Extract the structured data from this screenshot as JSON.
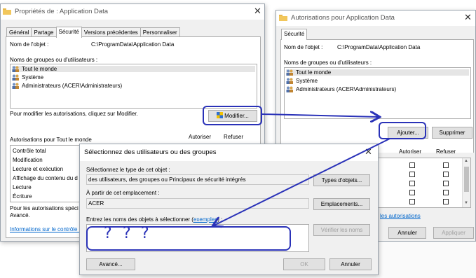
{
  "props_window": {
    "title": "Propriétés de : Application Data",
    "tabs": [
      "Général",
      "Partage",
      "Sécurité",
      "Versions précédentes",
      "Personnaliser"
    ],
    "object_name_label": "Nom de l'objet :",
    "object_name_value": "C:\\ProgramData\\Application Data",
    "groups_label": "Noms de groupes ou d'utilisateurs :",
    "groups": [
      "Tout le monde",
      "Système",
      "Administrateurs (ACER\\Administrateurs)"
    ],
    "modify_hint": "Pour modifier les autorisations, cliquez sur Modifier.",
    "modify_button": "Modifier...",
    "perms_label": "Autorisations pour Tout le monde",
    "allow_header": "Autoriser",
    "deny_header": "Refuser",
    "perms": [
      "Contrôle total",
      "Modification",
      "Lecture et exécution",
      "Affichage du contenu du d",
      "Lecture",
      "Écriture"
    ],
    "special_text_1": "Pour les autorisations spéci",
    "special_text_2": "Avancé.",
    "info_link": "Informations sur le contrôle d"
  },
  "auth_window": {
    "title": "Autorisations pour Application Data",
    "tab": "Sécurité",
    "object_name_label": "Nom de l'objet :",
    "object_name_value": "C:\\ProgramData\\Application Data",
    "groups_label": "Noms de groupes ou d'utilisateurs :",
    "groups": [
      "Tout le monde",
      "Système",
      "Administrateurs (ACER\\Administrateurs)"
    ],
    "add_button": "Ajouter...",
    "remove_button": "Supprimer",
    "allow_header": "Autoriser",
    "deny_header": "Refuser",
    "link_partial": "les autorisations",
    "cancel_button": "Annuler",
    "apply_button": "Appliquer"
  },
  "select_dialog": {
    "title": "Sélectionnez des utilisateurs ou des groupes",
    "type_label": "Sélectionnez le type de cet objet :",
    "type_value": "des utilisateurs, des groupes ou Principaux de sécurité intégrés",
    "types_button": "Types d'objets...",
    "location_label": "À partir de cet emplacement :",
    "location_value": "ACER",
    "locations_button": "Emplacements...",
    "names_label_prefix": "Entrez les noms des objets à sélectionner (",
    "names_label_link": "exemples",
    "names_label_suffix": ") :",
    "check_names_button": "Vérifier les noms",
    "advanced_button": "Avancé...",
    "ok_button": "OK",
    "cancel_button": "Annuler"
  },
  "annotation": {
    "question_marks": [
      "?",
      "?",
      "?"
    ],
    "color": "#2a32b8"
  }
}
